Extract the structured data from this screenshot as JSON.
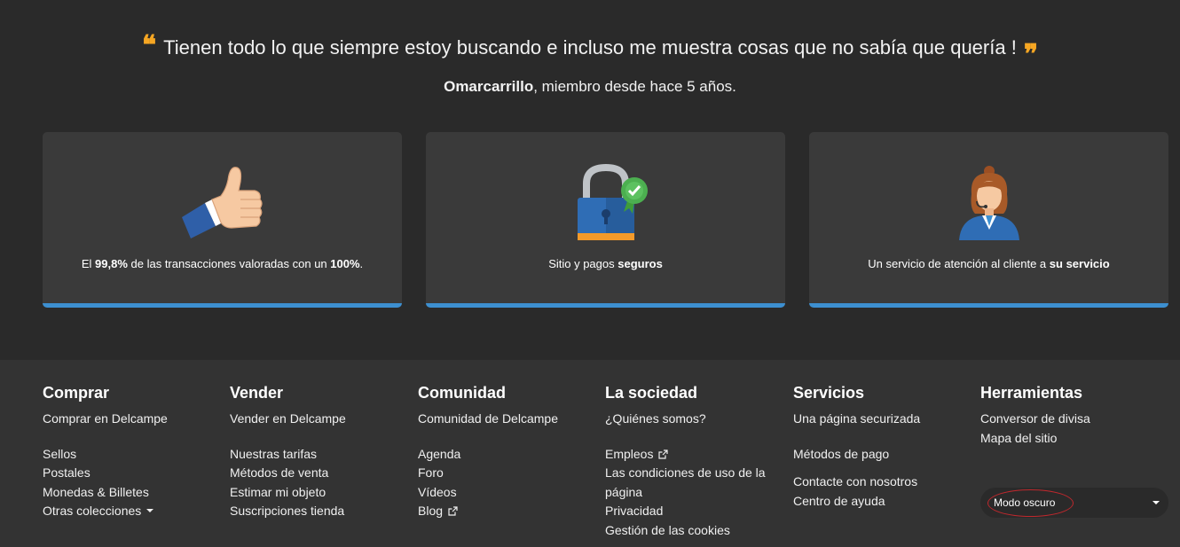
{
  "testimonial": {
    "quote": "Tienen todo lo que siempre estoy buscando e incluso me muestra cosas que no sabía que quería !",
    "open_mark": "❝",
    "close_mark": "❞",
    "author": "Omarcarrillo",
    "author_suffix": ", miembro desde hace 5 años."
  },
  "cards": [
    {
      "icon": "thumbs-up-icon",
      "pre": "El ",
      "b1": "99,8%",
      "mid": " de las transacciones valoradas con un ",
      "b2": "100%",
      "post": "."
    },
    {
      "icon": "padlock-icon",
      "pre": "Sitio y pagos ",
      "b1": "seguros"
    },
    {
      "icon": "support-agent-icon",
      "pre": "Un servicio de atención al cliente a ",
      "b1": "su servicio"
    }
  ],
  "colors": {
    "accent": "#3d8fd0",
    "quote": "#f5a623",
    "background": "#2a2a2a",
    "card": "#3a3a3a",
    "footer": "#333333",
    "ring": "#c0282d"
  },
  "footer": {
    "comprar": {
      "title": "Comprar",
      "main": "Comprar en Delcampe",
      "items": [
        "Sellos",
        "Postales",
        "Monedas & Billetes",
        "Otras colecciones"
      ]
    },
    "vender": {
      "title": "Vender",
      "main": "Vender en Delcampe",
      "items": [
        "Nuestras tarifas",
        "Métodos de venta",
        "Estimar mi objeto",
        "Suscripciones tienda"
      ]
    },
    "comunidad": {
      "title": "Comunidad",
      "main": "Comunidad de Delcampe",
      "items": [
        "Agenda",
        "Foro",
        "Vídeos",
        "Blog"
      ]
    },
    "sociedad": {
      "title": "La sociedad",
      "main": "¿Quiénes somos?",
      "items": [
        "Empleos",
        "Las condiciones de uso de la página",
        "Privacidad",
        "Gestión de las cookies"
      ]
    },
    "servicios": {
      "title": "Servicios",
      "main": "Una página securizada",
      "items": [
        "Métodos de pago",
        "Contacte con nosotros",
        "Centro de ayuda"
      ]
    },
    "herramientas": {
      "title": "Herramientas",
      "items": [
        "Conversor de divisa",
        "Mapa del sitio"
      ],
      "dark_mode_select": "Modo oscuro"
    }
  }
}
